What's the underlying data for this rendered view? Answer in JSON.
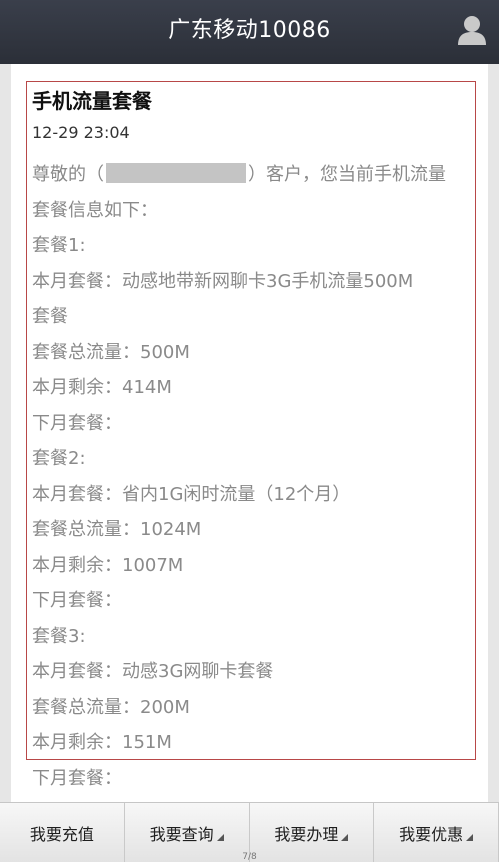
{
  "header": {
    "title": "广东移动10086"
  },
  "message": {
    "title": "手机流量套餐",
    "time": "12-29 23:04",
    "greeting_prefix": "尊敬的（",
    "greeting_suffix": "）客户，您当前手机流量",
    "lines": [
      "套餐信息如下：",
      "套餐1:",
      "本月套餐：动感地带新网聊卡3G手机流量500M",
      "套餐",
      "套餐总流量：500M",
      "本月剩余：414M",
      "下月套餐：",
      "套餐2:",
      "本月套餐：省内1G闲时流量（12个月）",
      "套餐总流量：1024M",
      "本月剩余：1007M",
      "下月套餐：",
      "套餐3:",
      "本月套餐：动感3G网聊卡套餐",
      "套餐总流量：200M",
      "本月剩余：151M",
      "下月套餐："
    ]
  },
  "footer": {
    "buttons": [
      {
        "label": "我要充值"
      },
      {
        "label": "我要查询"
      },
      {
        "label": "我要办理"
      },
      {
        "label": "我要优惠"
      }
    ],
    "page_indicator": "7/8"
  },
  "colors": {
    "header_bg": "#2f333d",
    "box_border": "#b84848",
    "text_gray": "#8a8a8a"
  }
}
